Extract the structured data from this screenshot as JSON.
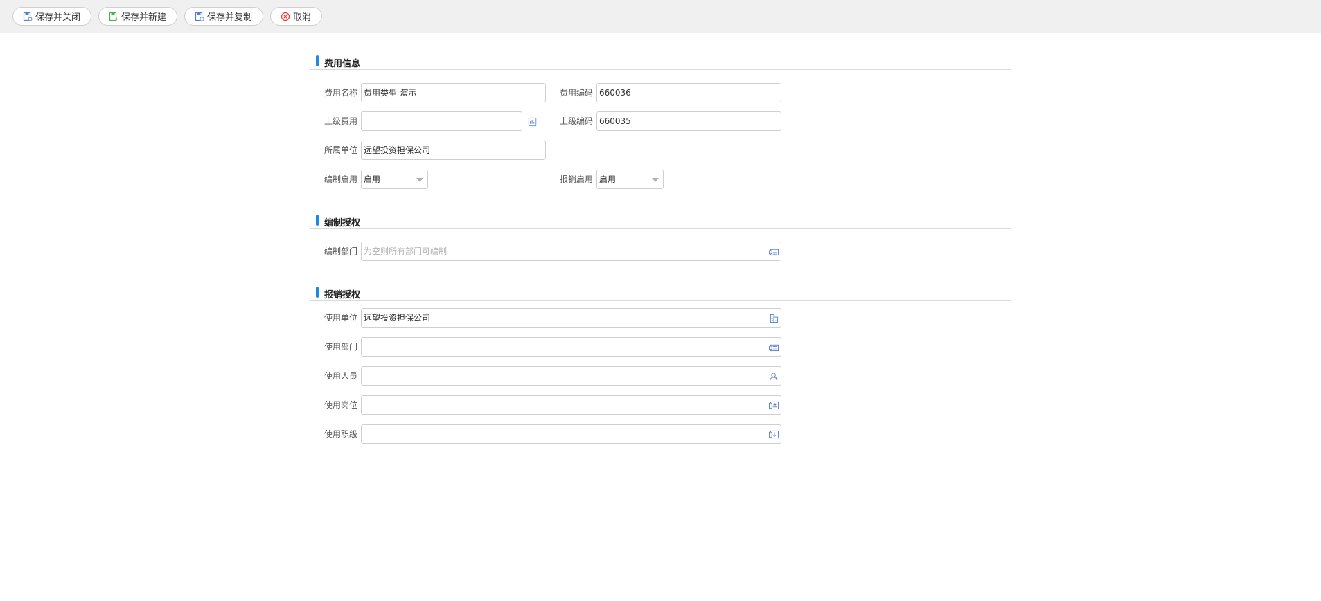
{
  "toolbar": {
    "save_close": "保存并关闭",
    "save_new": "保存并新建",
    "save_copy": "保存并复制",
    "cancel": "取消"
  },
  "sections": {
    "expense_info": "费用信息",
    "compile_auth": "编制授权",
    "reimburse_auth": "报销授权"
  },
  "fields": {
    "expense_name": {
      "label": "费用名称",
      "value": "费用类型-演示"
    },
    "expense_code": {
      "label": "费用编码",
      "value": "660036"
    },
    "parent_expense": {
      "label": "上级费用",
      "value": ""
    },
    "parent_code": {
      "label": "上级编码",
      "value": "660035"
    },
    "owner_unit": {
      "label": "所属单位",
      "value": "远望投资担保公司"
    },
    "compile_enabled": {
      "label": "编制启用",
      "value": "启用"
    },
    "reimburse_enabled": {
      "label": "报销启用",
      "value": "启用"
    },
    "compile_dept": {
      "label": "编制部门",
      "value": "",
      "placeholder": "为空则所有部门可编制"
    },
    "use_unit": {
      "label": "使用单位",
      "value": "远望投资担保公司"
    },
    "use_dept": {
      "label": "使用部门",
      "value": ""
    },
    "use_person": {
      "label": "使用人员",
      "value": ""
    },
    "use_post": {
      "label": "使用岗位",
      "value": ""
    },
    "use_rank": {
      "label": "使用职级",
      "value": ""
    }
  },
  "icons": {
    "save_close": "save-close-icon",
    "save_new": "save-new-icon",
    "save_copy": "save-copy-icon",
    "cancel": "cancel-circle-icon",
    "parent_picker": "tree-picker-icon",
    "dept": "department-icon",
    "unit": "building-icon",
    "person": "person-icon",
    "post": "post-icon",
    "rank": "rank-icon"
  },
  "colors": {
    "accent": "#1e88e5",
    "toolbar_bg": "#f0f0f0",
    "icon_blue": "#5b7fc7",
    "icon_green": "#4caf50",
    "cancel_red": "#e53935"
  }
}
